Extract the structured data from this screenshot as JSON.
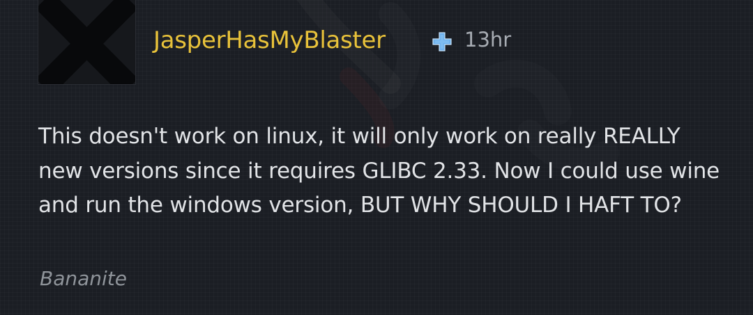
{
  "comment": {
    "author": "JasperHasMyBlaster",
    "author_color": "#e8c23a",
    "timestamp": "13hr",
    "body": "This doesn't work on linux, it will only work on really REALLY new versions since it requires GLIBC 2.33. Now I could use wine and run the windows version, BUT WHY SHOULD I HAFT TO?",
    "game": "Bananite",
    "avatar_icon": "x-mark-avatar",
    "badge_icon": "plus-badge-icon"
  },
  "colors": {
    "background": "#1b1e24",
    "body_text": "#e2e4e7",
    "muted_text": "#a7acb3",
    "badge_blue": "#6db0ec"
  }
}
